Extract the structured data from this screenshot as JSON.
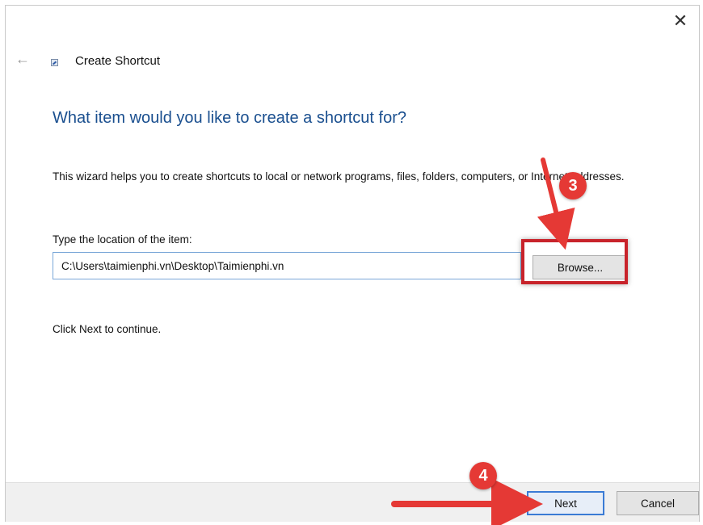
{
  "window": {
    "close_glyph": "✕",
    "back_glyph": "←",
    "title": "Create Shortcut"
  },
  "wizard": {
    "heading": "What item would you like to create a shortcut for?",
    "description": "This wizard helps you to create shortcuts to local or network programs, files, folders, computers, or Internet addresses.",
    "location_label": "Type the location of the item:",
    "location_value": "C:\\Users\\taimienphi.vn\\Desktop\\Taimienphi.vn",
    "browse_label": "Browse...",
    "hint": "Click Next to continue."
  },
  "footer": {
    "next_label": "Next",
    "cancel_label": "Cancel"
  },
  "annotations": {
    "step_browse": "3",
    "step_next": "4",
    "highlight_color": "#c8232b",
    "badge_color": "#e53935"
  }
}
